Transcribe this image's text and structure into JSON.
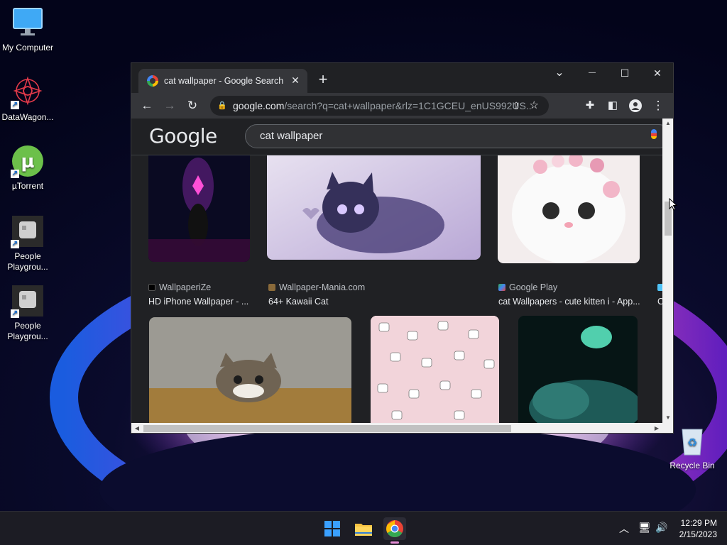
{
  "desktop": {
    "icons": [
      {
        "label": "My Computer",
        "icon": "monitor-icon"
      },
      {
        "label": "DataWagon...",
        "icon": "datawagon-logo-icon"
      },
      {
        "label": "µTorrent",
        "icon": "utorrent-icon"
      },
      {
        "label": "People Playgrou...",
        "icon": "app-icon"
      },
      {
        "label": "People Playgrou...",
        "icon": "app-icon"
      },
      {
        "label": "Recycle Bin",
        "icon": "recycle-bin-icon"
      }
    ]
  },
  "browser": {
    "tab_title": "cat wallpaper - Google Search",
    "url_host": "google.com",
    "url_path": "/search?q=cat+wallpaper&rlz=1C1GCEU_enUS992US...",
    "window_controls": {
      "dropdown": "⌄",
      "minimize": "—",
      "maximize": "☐",
      "close": "✕"
    }
  },
  "google": {
    "logo": "Google",
    "query": "cat wallpaper",
    "results": [
      {
        "source": "WallpaperiZe",
        "caption": "HD iPhone Wallpaper - ...",
        "source_color": "#202124"
      },
      {
        "source": "Wallpaper-Mania.com",
        "caption": "64+ Kawaii Cat",
        "source_color": "#8a6a3a"
      },
      {
        "source": "Google Play",
        "caption": "cat Wallpapers - cute kitten i - App...",
        "source_color": "#34a853"
      },
      {
        "source": "",
        "caption": "C",
        "source_color": "#4fc3f7"
      }
    ]
  },
  "taskbar": {
    "time": "12:29 PM",
    "date": "2/15/2023",
    "apps": [
      "start-icon",
      "file-explorer-icon",
      "chrome-icon"
    ]
  },
  "colors": {
    "accent": "#8ab4f8",
    "taskbar": "#1c1c24",
    "chrome_dark": "#202124"
  }
}
